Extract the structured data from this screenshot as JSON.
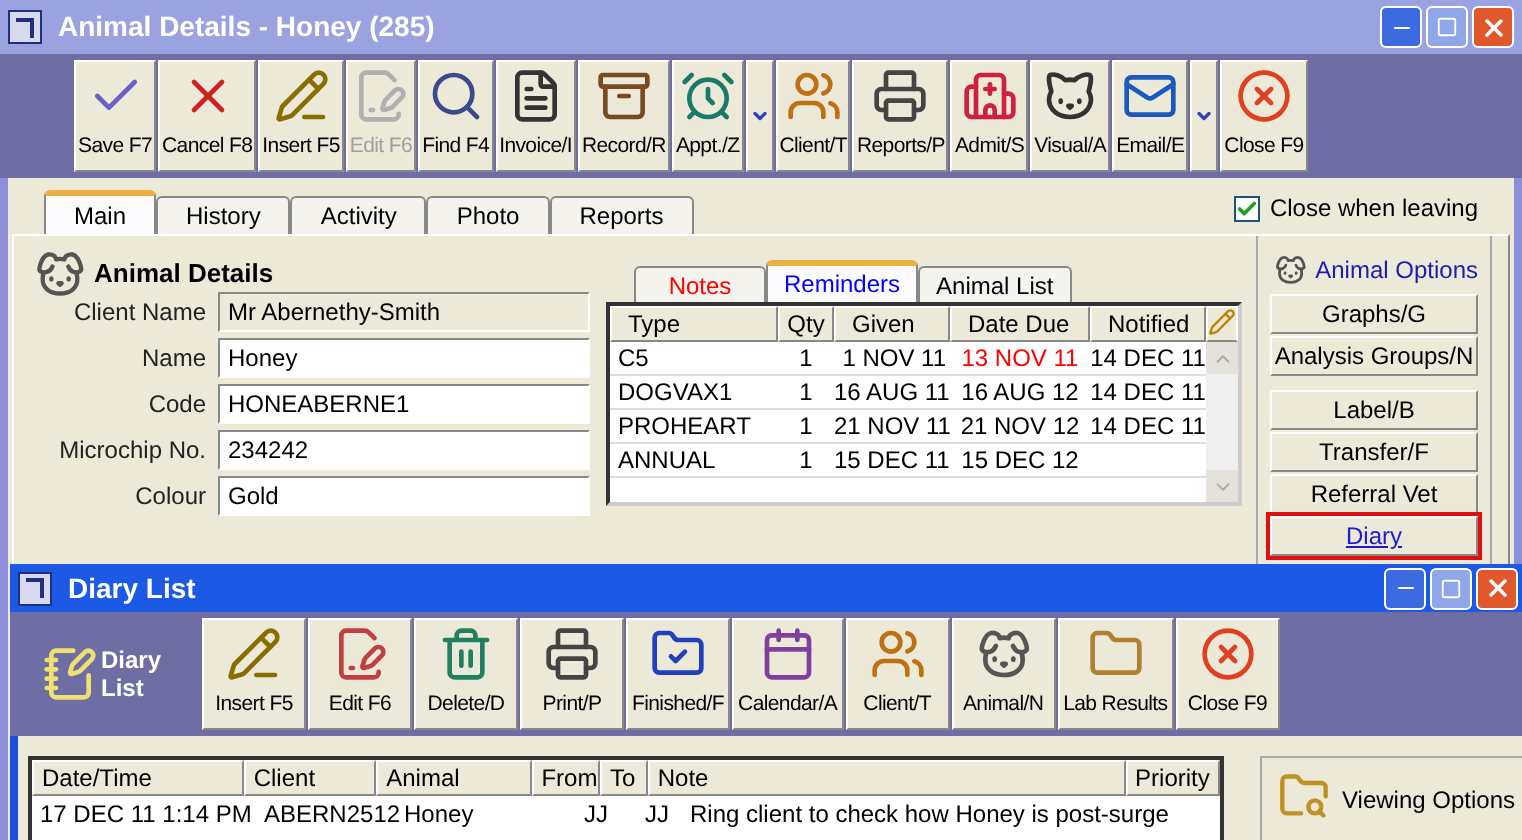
{
  "animal_window": {
    "title": "Animal Details - Honey (285)",
    "toolbar": [
      {
        "label": "Save F7",
        "disabled": false,
        "dropdown": false
      },
      {
        "label": "Cancel F8",
        "disabled": false,
        "dropdown": false
      },
      {
        "label": "Insert F5",
        "disabled": false,
        "dropdown": false
      },
      {
        "label": "Edit F6",
        "disabled": true,
        "dropdown": false
      },
      {
        "label": "Find F4",
        "disabled": false,
        "dropdown": false
      },
      {
        "label": "Invoice/I",
        "disabled": false,
        "dropdown": false
      },
      {
        "label": "Record/R",
        "disabled": false,
        "dropdown": false
      },
      {
        "label": "Appt./Z",
        "disabled": false,
        "dropdown": true
      },
      {
        "label": "Client/T",
        "disabled": false,
        "dropdown": false
      },
      {
        "label": "Reports/P",
        "disabled": false,
        "dropdown": false
      },
      {
        "label": "Admit/S",
        "disabled": false,
        "dropdown": false
      },
      {
        "label": "Visual/A",
        "disabled": false,
        "dropdown": false
      },
      {
        "label": "Email/E",
        "disabled": false,
        "dropdown": true
      },
      {
        "label": "Close F9",
        "disabled": false,
        "dropdown": false
      }
    ],
    "tabs": [
      {
        "label": "Main",
        "selected": true
      },
      {
        "label": "History",
        "selected": false
      },
      {
        "label": "Activity",
        "selected": false
      },
      {
        "label": "Photo",
        "selected": false
      },
      {
        "label": "Reports",
        "selected": false
      }
    ],
    "close_when_leaving": {
      "label": "Close when leaving",
      "checked": true
    },
    "details": {
      "heading": "Animal Details",
      "fields": [
        {
          "label": "Client Name",
          "value": "Mr Abernethy-Smith",
          "readonly": true
        },
        {
          "label": "Name",
          "value": "Honey",
          "readonly": false
        },
        {
          "label": "Code",
          "value": "HONEABERNE1",
          "readonly": false
        },
        {
          "label": "Microchip No.",
          "value": "234242",
          "readonly": false
        },
        {
          "label": "Colour",
          "value": "Gold",
          "readonly": false
        }
      ]
    },
    "sub_tabs": [
      {
        "label": "Notes",
        "selected": false,
        "color": "#ff0000"
      },
      {
        "label": "Reminders",
        "selected": true,
        "color": "#0000ff"
      },
      {
        "label": "Animal List",
        "selected": false,
        "color": "#000000"
      }
    ],
    "reminders": {
      "columns": [
        "Type",
        "Qty",
        "Given",
        "Date Due",
        "Notified"
      ],
      "rows": [
        {
          "cells": [
            "C5",
            "1",
            "1 NOV 11",
            "13 NOV 11",
            "14 DEC 11"
          ],
          "overdue": true
        },
        {
          "cells": [
            "DOGVAX1",
            "1",
            "16 AUG 11",
            "16 AUG 12",
            "14 DEC 11"
          ],
          "overdue": false
        },
        {
          "cells": [
            "PROHEART",
            "1",
            "21 NOV 11",
            "21 NOV 12",
            "14 DEC 11"
          ],
          "overdue": false
        },
        {
          "cells": [
            "ANNUAL",
            "1",
            "15 DEC 11",
            "15 DEC 12",
            ""
          ],
          "overdue": false
        }
      ]
    },
    "options": {
      "heading": "Animal Options",
      "buttons": [
        {
          "label": "Graphs/G",
          "highlighted": false
        },
        {
          "label": "Analysis Groups/N",
          "highlighted": false
        },
        {
          "label": "Label/B",
          "highlighted": false
        },
        {
          "label": "Transfer/F",
          "highlighted": false
        },
        {
          "label": "Referral Vet",
          "highlighted": false
        },
        {
          "label": "Diary",
          "highlighted": true
        }
      ]
    }
  },
  "diary_window": {
    "title": "Diary List",
    "logo_label": "Diary List",
    "toolbar": [
      "Insert F5",
      "Edit F6",
      "Delete/D",
      "Print/P",
      "Finished/F",
      "Calendar/A",
      "Client/T",
      "Animal/N",
      "Lab Results",
      "Close F9"
    ],
    "columns": [
      "Date/Time",
      "Client",
      "Animal",
      "From",
      "To",
      "Note",
      "Priority"
    ],
    "rows": [
      {
        "cells": [
          "17 DEC 11  1:14 PM",
          "ABERN2512",
          "Honey",
          "JJ",
          "JJ",
          "Ring client to check how Honey is post-surge",
          ""
        ]
      }
    ],
    "viewing_options": "Viewing Options"
  }
}
